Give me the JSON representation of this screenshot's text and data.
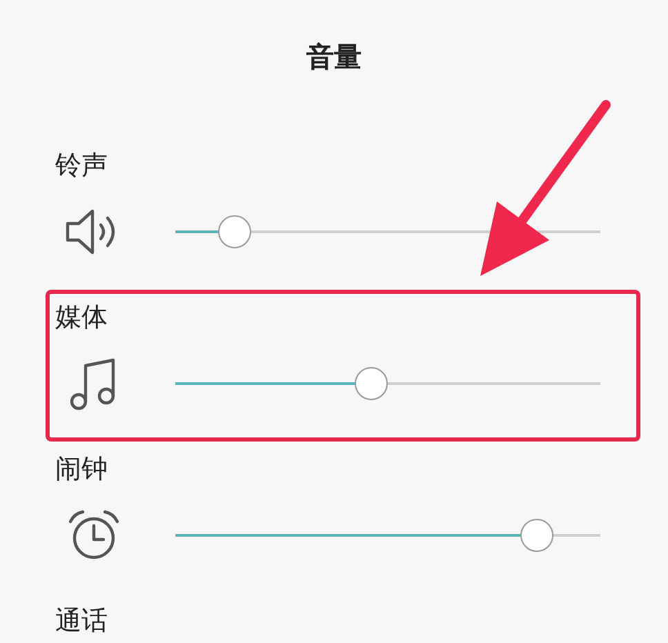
{
  "title": "音量",
  "channels": [
    {
      "name": "铃声",
      "kind": "ringtone",
      "level": 0.14,
      "highlighted": false
    },
    {
      "name": "媒体",
      "kind": "media",
      "level": 0.46,
      "highlighted": true
    },
    {
      "name": "闹钟",
      "kind": "alarm",
      "level": 0.85,
      "highlighted": false
    },
    {
      "name": "通话",
      "kind": "call",
      "highlighted": false
    }
  ]
}
